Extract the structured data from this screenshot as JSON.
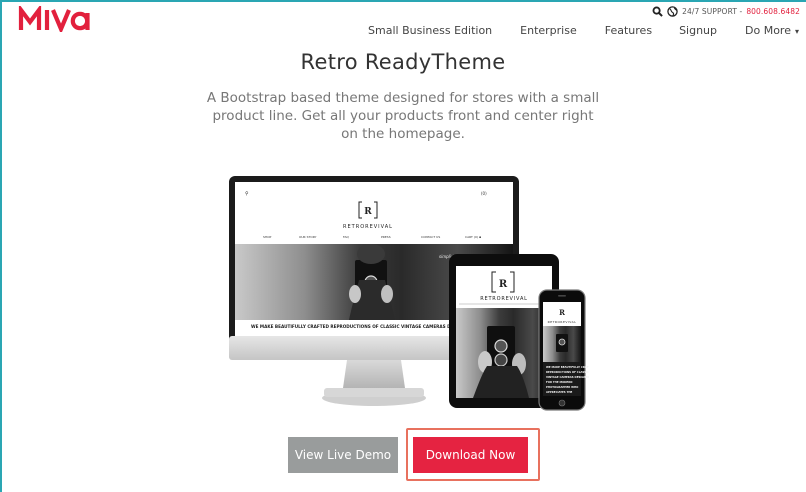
{
  "brand": {
    "logo_text": "MIVA",
    "accent": "#e2203d",
    "frame_color": "#2aa6b3"
  },
  "utility": {
    "support_label": "24/7 SUPPORT -",
    "support_phone": "800.608.6482",
    "icons": [
      "search-icon",
      "globe-icon"
    ]
  },
  "nav": {
    "items": [
      {
        "label": "Small Business Edition"
      },
      {
        "label": "Enterprise"
      },
      {
        "label": "Features"
      },
      {
        "label": "Signup"
      },
      {
        "label": "Do More",
        "caret": "▾"
      }
    ]
  },
  "hero": {
    "title": "Retro ReadyTheme",
    "subtitle": "A Bootstrap based theme designed for stores with a small product line. Get all your products front and center right on the homepage."
  },
  "mockup": {
    "site_name": "RETROREVIVAL",
    "monogram": "RR",
    "cart": "(0)",
    "menu": [
      "SHOP",
      "OUR STORY",
      "FAQ",
      "PRESS",
      "CONTACT US",
      "CART (0)"
    ],
    "banner": "WE MAKE BEAUTIFULLY CRAFTED REPRODUCTIONS OF CLASSIC VINTAGE CAMERAS D",
    "phone_text": [
      "WE MAKE BEAUTIFULLY CRAFTED",
      "REPRODUCTIONS OF CLASSIC",
      "VINTAGE CAMERAS DESIGNED",
      "FOR THE MODERN",
      "PHOTOGRAPHER WHO",
      "APPRECIATES THE"
    ]
  },
  "actions": {
    "demo_label": "View Live Demo",
    "download_label": "Download Now",
    "demo_color": "#999c9c",
    "download_color": "#e52341"
  }
}
